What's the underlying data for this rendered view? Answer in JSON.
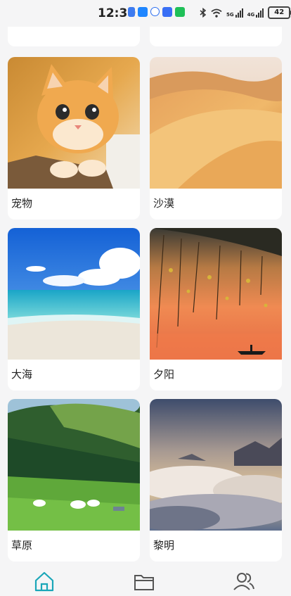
{
  "status_bar": {
    "time": "12:30",
    "network_1": "5G",
    "network_2": "4G",
    "battery": "42"
  },
  "cards": [
    {
      "label": "宠物",
      "image": "orange-kitten-photo"
    },
    {
      "label": "沙漠",
      "image": "desert-dunes-photo"
    },
    {
      "label": "大海",
      "image": "beach-sea-photo"
    },
    {
      "label": "夕阳",
      "image": "sunset-lake-photo"
    },
    {
      "label": "草原",
      "image": "grassland-photo"
    },
    {
      "label": "黎明",
      "image": "dawn-clouds-photo"
    }
  ],
  "bottom_nav": [
    {
      "name": "home-icon",
      "active": true
    },
    {
      "name": "folder-icon",
      "active": false
    },
    {
      "name": "users-icon",
      "active": false
    }
  ],
  "colors": {
    "accent": "#1aa6b8",
    "inactive": "#555555",
    "background": "#f5f5f6"
  }
}
